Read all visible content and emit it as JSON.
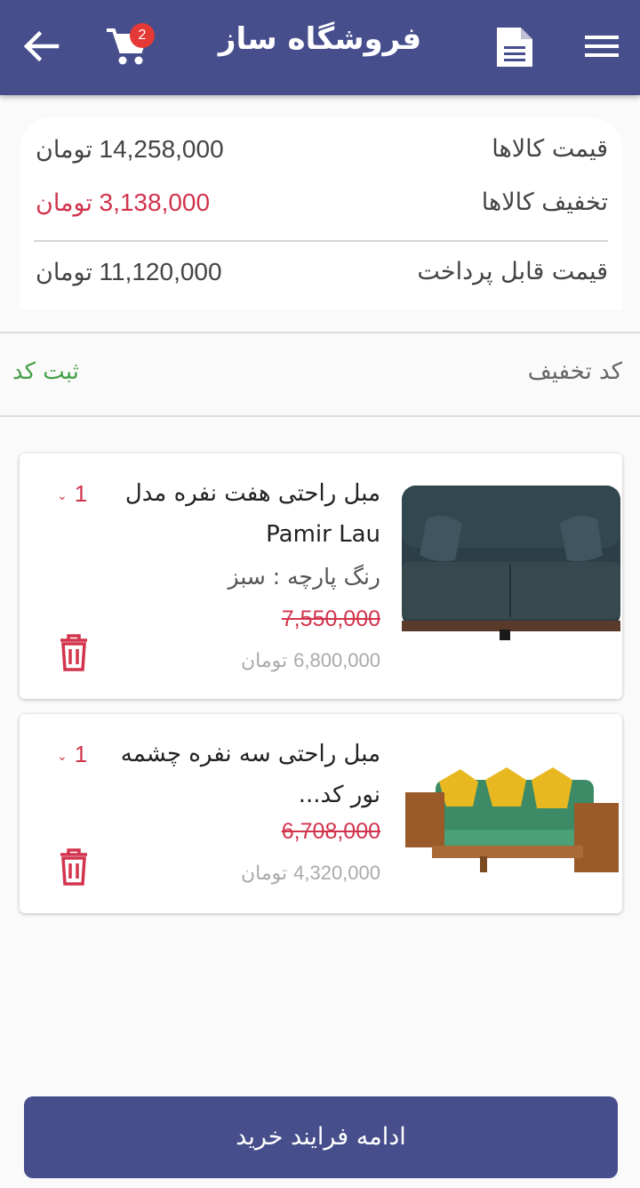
{
  "app": {
    "title": "فروشگاه ساز",
    "cart_count": "2"
  },
  "summary": {
    "items_price_label": "قیمت کالاها",
    "items_price_value": "14,258,000",
    "items_discount_label": "تخفیف کالاها",
    "items_discount_value": "3,138,000",
    "payable_label": "قیمت قابل پرداخت",
    "payable_value": "11,120,000",
    "currency": "تومان"
  },
  "discount_code": {
    "label": "کد تخفیف",
    "submit_label": "ثبت کد"
  },
  "items": [
    {
      "name": "مبل راحتی هفت نفره مدل Pamir Lau",
      "variant": "رنگ پارچه : سبز",
      "old_price": "7,550,000",
      "price": "6,800,000",
      "currency": "تومان",
      "qty": "1",
      "image": "sofa-dark-green"
    },
    {
      "name": "مبل راحتی سه نفره چشمه نور کد...",
      "old_price": "6,708,000",
      "price": "4,320,000",
      "currency": "تومان",
      "qty": "1",
      "image": "sofa-wooden-arms-yellow-cushions"
    }
  ],
  "checkout": {
    "label": "ادامه فرایند خرید"
  },
  "colors": {
    "primary": "#474e8c",
    "danger": "#d2344d",
    "success": "#43a047",
    "badge": "#e53935"
  }
}
